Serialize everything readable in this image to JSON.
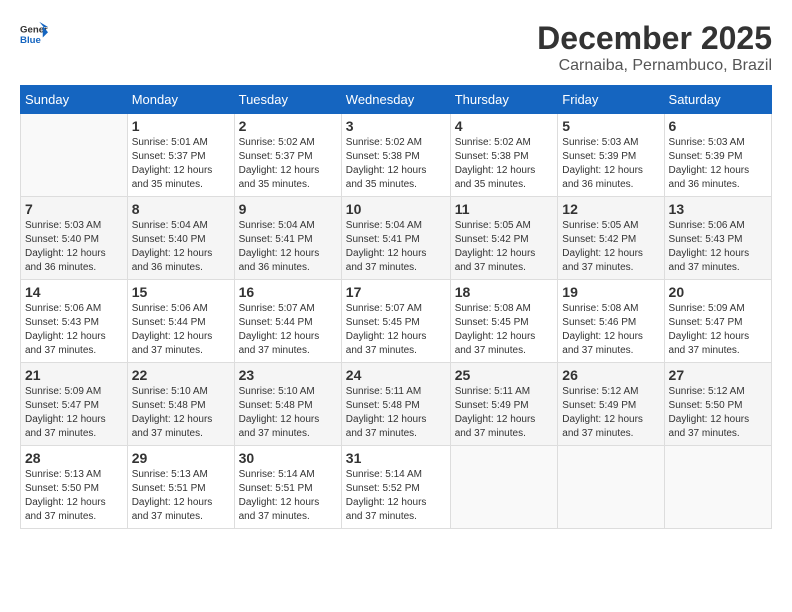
{
  "logo": {
    "text_general": "General",
    "text_blue": "Blue"
  },
  "header": {
    "month": "December 2025",
    "location": "Carnaiba, Pernambuco, Brazil"
  },
  "weekdays": [
    "Sunday",
    "Monday",
    "Tuesday",
    "Wednesday",
    "Thursday",
    "Friday",
    "Saturday"
  ],
  "weeks": [
    [
      {
        "day": "",
        "sunrise": "",
        "sunset": "",
        "daylight": ""
      },
      {
        "day": "1",
        "sunrise": "Sunrise: 5:01 AM",
        "sunset": "Sunset: 5:37 PM",
        "daylight": "Daylight: 12 hours and 35 minutes."
      },
      {
        "day": "2",
        "sunrise": "Sunrise: 5:02 AM",
        "sunset": "Sunset: 5:37 PM",
        "daylight": "Daylight: 12 hours and 35 minutes."
      },
      {
        "day": "3",
        "sunrise": "Sunrise: 5:02 AM",
        "sunset": "Sunset: 5:38 PM",
        "daylight": "Daylight: 12 hours and 35 minutes."
      },
      {
        "day": "4",
        "sunrise": "Sunrise: 5:02 AM",
        "sunset": "Sunset: 5:38 PM",
        "daylight": "Daylight: 12 hours and 35 minutes."
      },
      {
        "day": "5",
        "sunrise": "Sunrise: 5:03 AM",
        "sunset": "Sunset: 5:39 PM",
        "daylight": "Daylight: 12 hours and 36 minutes."
      },
      {
        "day": "6",
        "sunrise": "Sunrise: 5:03 AM",
        "sunset": "Sunset: 5:39 PM",
        "daylight": "Daylight: 12 hours and 36 minutes."
      }
    ],
    [
      {
        "day": "7",
        "sunrise": "Sunrise: 5:03 AM",
        "sunset": "Sunset: 5:40 PM",
        "daylight": "Daylight: 12 hours and 36 minutes."
      },
      {
        "day": "8",
        "sunrise": "Sunrise: 5:04 AM",
        "sunset": "Sunset: 5:40 PM",
        "daylight": "Daylight: 12 hours and 36 minutes."
      },
      {
        "day": "9",
        "sunrise": "Sunrise: 5:04 AM",
        "sunset": "Sunset: 5:41 PM",
        "daylight": "Daylight: 12 hours and 36 minutes."
      },
      {
        "day": "10",
        "sunrise": "Sunrise: 5:04 AM",
        "sunset": "Sunset: 5:41 PM",
        "daylight": "Daylight: 12 hours and 37 minutes."
      },
      {
        "day": "11",
        "sunrise": "Sunrise: 5:05 AM",
        "sunset": "Sunset: 5:42 PM",
        "daylight": "Daylight: 12 hours and 37 minutes."
      },
      {
        "day": "12",
        "sunrise": "Sunrise: 5:05 AM",
        "sunset": "Sunset: 5:42 PM",
        "daylight": "Daylight: 12 hours and 37 minutes."
      },
      {
        "day": "13",
        "sunrise": "Sunrise: 5:06 AM",
        "sunset": "Sunset: 5:43 PM",
        "daylight": "Daylight: 12 hours and 37 minutes."
      }
    ],
    [
      {
        "day": "14",
        "sunrise": "Sunrise: 5:06 AM",
        "sunset": "Sunset: 5:43 PM",
        "daylight": "Daylight: 12 hours and 37 minutes."
      },
      {
        "day": "15",
        "sunrise": "Sunrise: 5:06 AM",
        "sunset": "Sunset: 5:44 PM",
        "daylight": "Daylight: 12 hours and 37 minutes."
      },
      {
        "day": "16",
        "sunrise": "Sunrise: 5:07 AM",
        "sunset": "Sunset: 5:44 PM",
        "daylight": "Daylight: 12 hours and 37 minutes."
      },
      {
        "day": "17",
        "sunrise": "Sunrise: 5:07 AM",
        "sunset": "Sunset: 5:45 PM",
        "daylight": "Daylight: 12 hours and 37 minutes."
      },
      {
        "day": "18",
        "sunrise": "Sunrise: 5:08 AM",
        "sunset": "Sunset: 5:45 PM",
        "daylight": "Daylight: 12 hours and 37 minutes."
      },
      {
        "day": "19",
        "sunrise": "Sunrise: 5:08 AM",
        "sunset": "Sunset: 5:46 PM",
        "daylight": "Daylight: 12 hours and 37 minutes."
      },
      {
        "day": "20",
        "sunrise": "Sunrise: 5:09 AM",
        "sunset": "Sunset: 5:47 PM",
        "daylight": "Daylight: 12 hours and 37 minutes."
      }
    ],
    [
      {
        "day": "21",
        "sunrise": "Sunrise: 5:09 AM",
        "sunset": "Sunset: 5:47 PM",
        "daylight": "Daylight: 12 hours and 37 minutes."
      },
      {
        "day": "22",
        "sunrise": "Sunrise: 5:10 AM",
        "sunset": "Sunset: 5:48 PM",
        "daylight": "Daylight: 12 hours and 37 minutes."
      },
      {
        "day": "23",
        "sunrise": "Sunrise: 5:10 AM",
        "sunset": "Sunset: 5:48 PM",
        "daylight": "Daylight: 12 hours and 37 minutes."
      },
      {
        "day": "24",
        "sunrise": "Sunrise: 5:11 AM",
        "sunset": "Sunset: 5:48 PM",
        "daylight": "Daylight: 12 hours and 37 minutes."
      },
      {
        "day": "25",
        "sunrise": "Sunrise: 5:11 AM",
        "sunset": "Sunset: 5:49 PM",
        "daylight": "Daylight: 12 hours and 37 minutes."
      },
      {
        "day": "26",
        "sunrise": "Sunrise: 5:12 AM",
        "sunset": "Sunset: 5:49 PM",
        "daylight": "Daylight: 12 hours and 37 minutes."
      },
      {
        "day": "27",
        "sunrise": "Sunrise: 5:12 AM",
        "sunset": "Sunset: 5:50 PM",
        "daylight": "Daylight: 12 hours and 37 minutes."
      }
    ],
    [
      {
        "day": "28",
        "sunrise": "Sunrise: 5:13 AM",
        "sunset": "Sunset: 5:50 PM",
        "daylight": "Daylight: 12 hours and 37 minutes."
      },
      {
        "day": "29",
        "sunrise": "Sunrise: 5:13 AM",
        "sunset": "Sunset: 5:51 PM",
        "daylight": "Daylight: 12 hours and 37 minutes."
      },
      {
        "day": "30",
        "sunrise": "Sunrise: 5:14 AM",
        "sunset": "Sunset: 5:51 PM",
        "daylight": "Daylight: 12 hours and 37 minutes."
      },
      {
        "day": "31",
        "sunrise": "Sunrise: 5:14 AM",
        "sunset": "Sunset: 5:52 PM",
        "daylight": "Daylight: 12 hours and 37 minutes."
      },
      {
        "day": "",
        "sunrise": "",
        "sunset": "",
        "daylight": ""
      },
      {
        "day": "",
        "sunrise": "",
        "sunset": "",
        "daylight": ""
      },
      {
        "day": "",
        "sunrise": "",
        "sunset": "",
        "daylight": ""
      }
    ]
  ]
}
